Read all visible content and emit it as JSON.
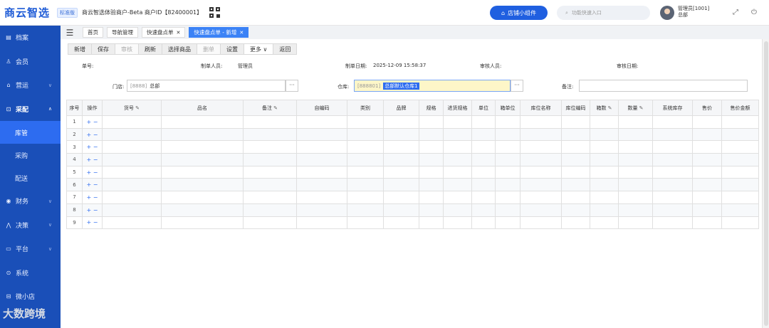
{
  "header": {
    "logo": "商云智选",
    "edition_badge": "标准版",
    "merchant_info": "商云智选体验商户-Beta  商户ID【82400001】",
    "store_widget_label": "店铺小组件",
    "search_placeholder": "功能快速入口",
    "user_name": "管理员[1001]",
    "user_dept": "总部"
  },
  "sidebar": {
    "items": [
      {
        "label": "档案",
        "icon": "archive-icon"
      },
      {
        "label": "会员",
        "icon": "member-icon"
      },
      {
        "label": "营运",
        "icon": "operations-icon"
      },
      {
        "label": "采配",
        "icon": "purchase-icon"
      },
      {
        "label": "财务",
        "icon": "finance-icon"
      },
      {
        "label": "决策",
        "icon": "decision-icon"
      },
      {
        "label": "平台",
        "icon": "platform-icon"
      },
      {
        "label": "系统",
        "icon": "system-icon"
      },
      {
        "label": "微小店",
        "icon": "shop-icon"
      }
    ],
    "sub_items": [
      "库管",
      "采购",
      "配送"
    ],
    "active_sub": "库管",
    "watermark": "大数跨境"
  },
  "tabs": [
    {
      "label": "首页",
      "closable": false,
      "active": false
    },
    {
      "label": "导航管理",
      "closable": false,
      "active": false
    },
    {
      "label": "快速盘点单",
      "closable": true,
      "active": false
    },
    {
      "label": "快速盘点单 - 新增",
      "closable": true,
      "active": true
    }
  ],
  "toolbar": [
    {
      "label": "新增",
      "disabled": false
    },
    {
      "label": "保存",
      "disabled": false
    },
    {
      "label": "审核",
      "disabled": true
    },
    {
      "label": "刷新",
      "disabled": false
    },
    {
      "label": "选择商品",
      "disabled": false
    },
    {
      "label": "删单",
      "disabled": true
    },
    {
      "label": "设置",
      "disabled": false
    },
    {
      "label": "更多 ∨",
      "disabled": false
    },
    {
      "label": "返回",
      "disabled": false
    }
  ],
  "meta": {
    "doc_no_label": "单号:",
    "maker_label": "制单人员:",
    "maker_value": "管理员",
    "make_date_label": "制单日期:",
    "make_date_value": "2025-12-09 15:58:37",
    "auditor_label": "审核人员:",
    "audit_date_label": "审核日期:"
  },
  "form": {
    "store_label": "门店:",
    "store_code": "[8888]",
    "store_name": "总部",
    "warehouse_label": "仓库:",
    "warehouse_code": "[888801]",
    "warehouse_name": "总部默认仓库1",
    "remark_label": "备注:",
    "dots": "···"
  },
  "grid": {
    "columns": [
      "序号",
      "操作",
      "货号",
      "品名",
      "备注",
      "自编码",
      "类别",
      "品牌",
      "规格",
      "进货规格",
      "单位",
      "箱单位",
      "库位名称",
      "库位编码",
      "箱数",
      "数量",
      "系统库存",
      "售价",
      "售价金额"
    ],
    "editable_columns": [
      "货号",
      "备注",
      "箱数",
      "数量"
    ],
    "rows": [
      "1",
      "2",
      "3",
      "4",
      "5",
      "6",
      "7",
      "8",
      "9"
    ],
    "row_ops": "+ −"
  }
}
